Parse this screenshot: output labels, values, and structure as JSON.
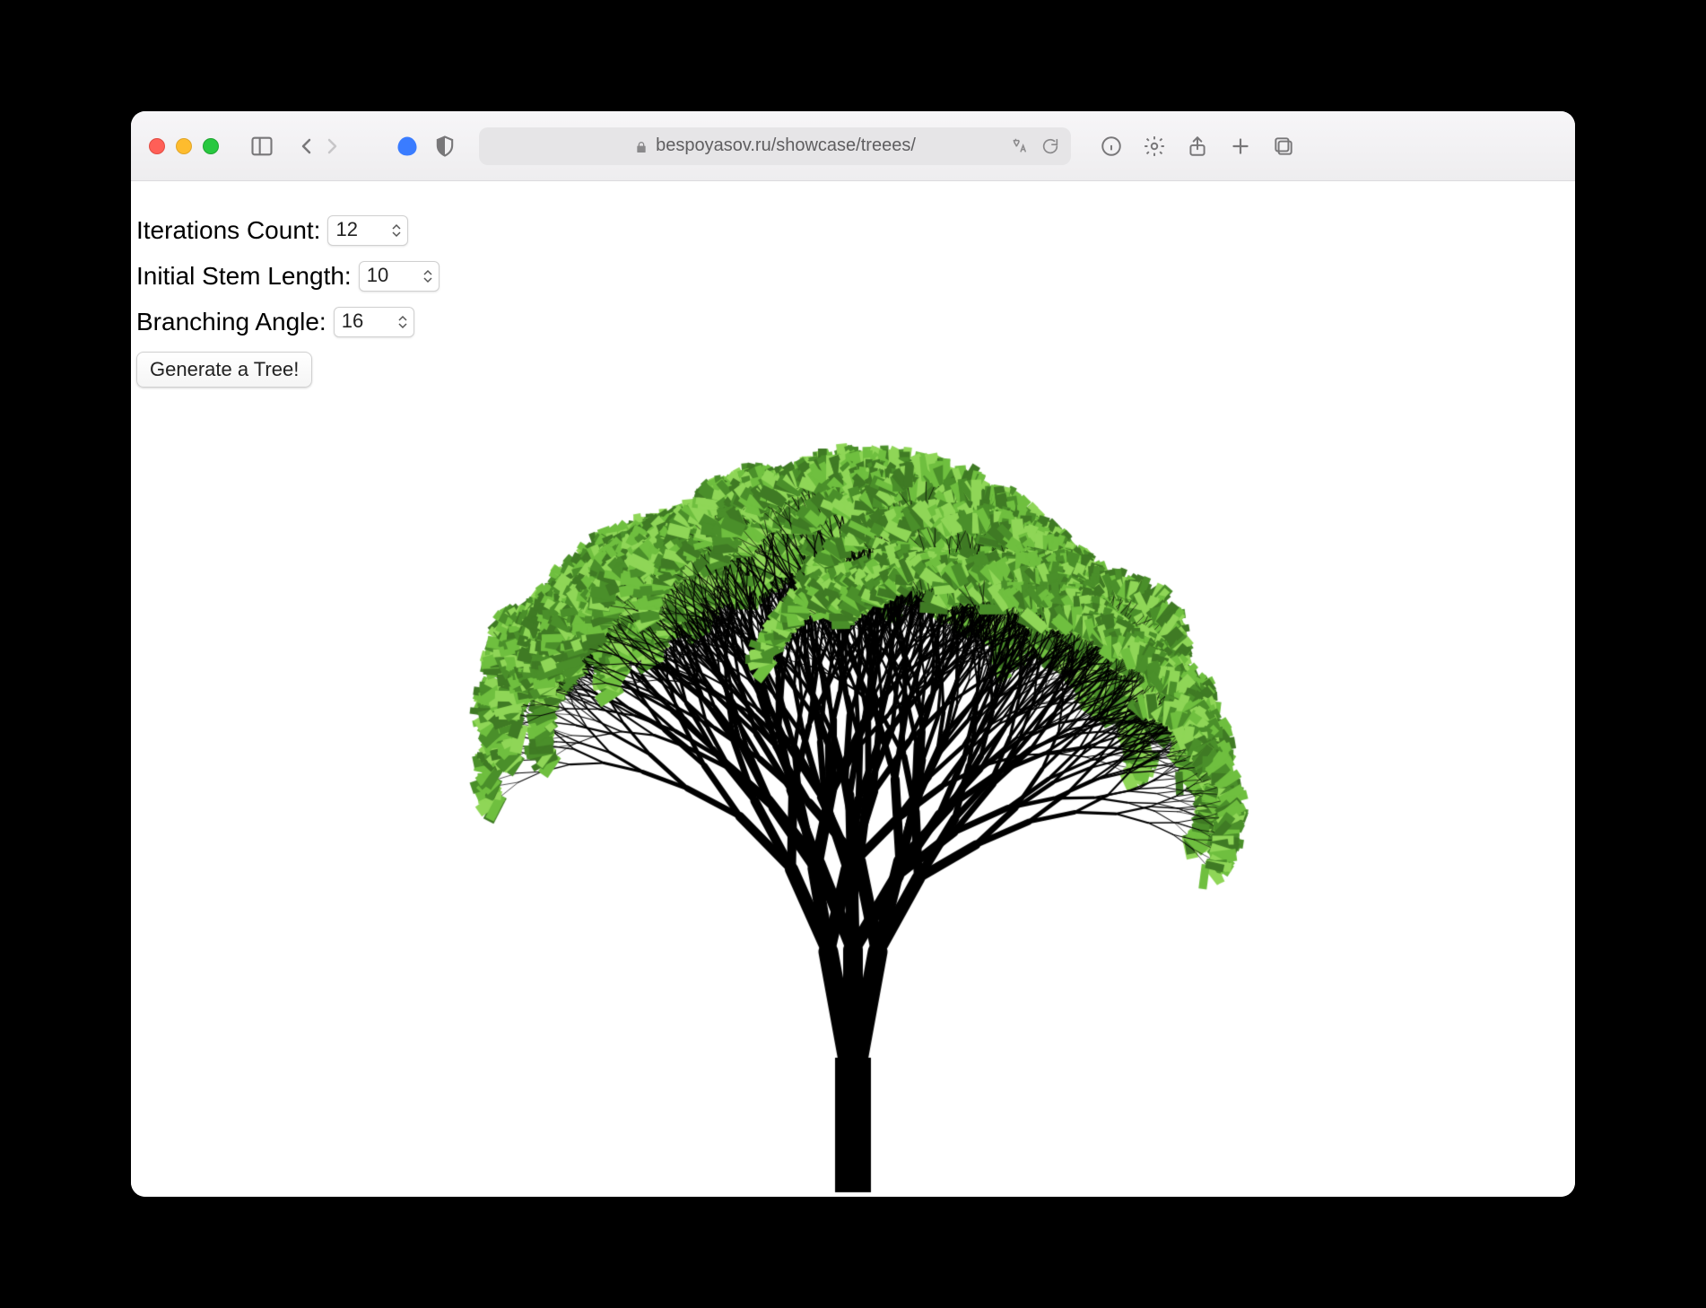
{
  "browser": {
    "url": "bespoyasov.ru/showcase/treees/"
  },
  "controls": {
    "iterations": {
      "label": "Iterations Count:",
      "value": "12"
    },
    "stem_length": {
      "label": "Initial Stem Length:",
      "value": "10"
    },
    "branch_angle": {
      "label": "Branching Angle:",
      "value": "16"
    },
    "generate_button": "Generate a Tree!"
  },
  "tree": {
    "iterations": 12,
    "initial_stem_length": 10,
    "branching_angle_deg": 16,
    "trunk_color": "#000000",
    "leaf_colors": [
      "#4a8f2a",
      "#6fbf3f",
      "#8fd657",
      "#3f7a24"
    ]
  }
}
